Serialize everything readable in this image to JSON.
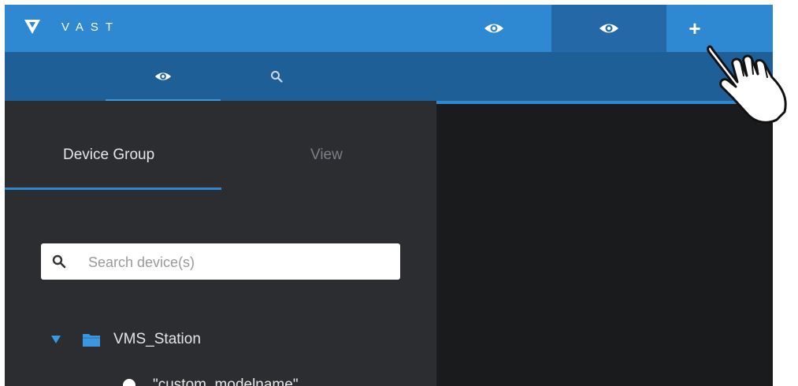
{
  "header": {
    "app_name": "VAST",
    "tabs": [
      {
        "icon": "eye-icon",
        "active": false
      },
      {
        "icon": "eye-icon",
        "active": true
      }
    ],
    "add_tab_label": "+"
  },
  "subnav": {
    "tabs": [
      {
        "icon": "eye-icon",
        "active": true
      },
      {
        "icon": "search-icon",
        "active": false
      }
    ]
  },
  "sidebar": {
    "tabs": [
      {
        "label": "Device Group",
        "active": true
      },
      {
        "label": "View",
        "active": false
      }
    ],
    "search": {
      "placeholder": "Search device(s)",
      "value": ""
    },
    "tree": {
      "root": {
        "label": "VMS_Station",
        "expanded": true,
        "icon": "folder-icon"
      },
      "children": [
        {
          "label": "\"custom_modelname\""
        }
      ]
    }
  },
  "colors": {
    "topbar": "#2f88d2",
    "active_tab": "#2468a7",
    "subbar": "#1e5f98",
    "sidebar": "#2b2d30",
    "viewer": "#1a1b1d",
    "accent": "#3a97e0"
  },
  "cursor": {
    "icon": "hand-pointer-icon"
  }
}
